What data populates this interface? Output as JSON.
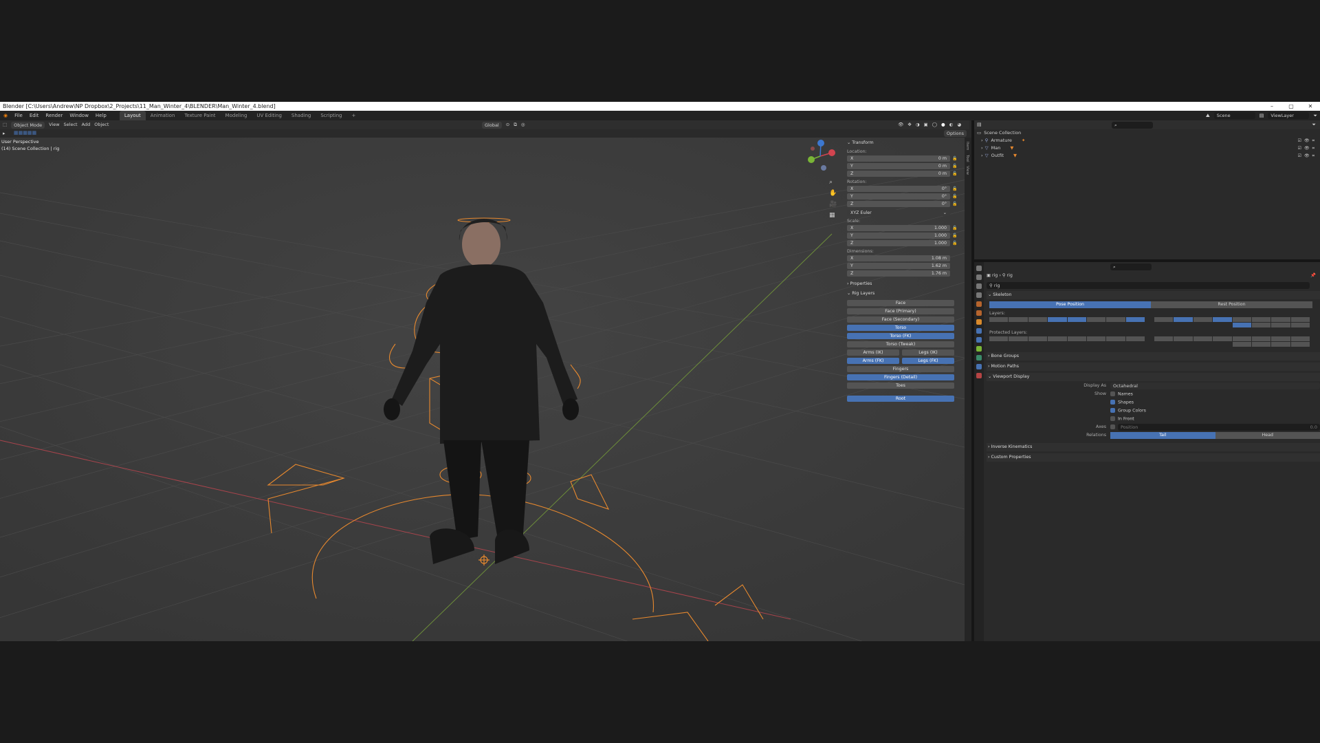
{
  "window": {
    "title": "Blender [C:\\Users\\Andrew\\NP Dropbox\\2_Projects\\11_Man_Winter_4\\BLENDER\\Man_Winter_4.blend]",
    "controls": [
      "–",
      "▢",
      "✕"
    ]
  },
  "menu": {
    "items": [
      "File",
      "Edit",
      "Render",
      "Window",
      "Help"
    ],
    "workspaces": [
      {
        "label": "Layout",
        "active": true
      },
      {
        "label": "Animation",
        "active": false
      },
      {
        "label": "Texture Paint",
        "active": false
      },
      {
        "label": "Modeling",
        "active": false
      },
      {
        "label": "UV Editing",
        "active": false
      },
      {
        "label": "Shading",
        "active": false
      },
      {
        "label": "Scripting",
        "active": false
      }
    ],
    "add_workspace": "+",
    "scene": "Scene",
    "view_layer": "ViewLayer"
  },
  "viewport_header": {
    "mode": "Object Mode",
    "menus": [
      "View",
      "Select",
      "Add",
      "Object"
    ],
    "orientation": "Global",
    "options": "Options"
  },
  "viewport": {
    "perspective": "User Perspective",
    "collection": "(14) Scene Collection | rig",
    "gizmo_axes": [
      "X",
      "Y",
      "Z"
    ]
  },
  "side_tabs": [
    "Item",
    "Tool",
    "View"
  ],
  "n_panel": {
    "transform_header": "Transform",
    "location_label": "Location:",
    "location": [
      {
        "axis": "X",
        "value": "0 m"
      },
      {
        "axis": "Y",
        "value": "0 m"
      },
      {
        "axis": "Z",
        "value": "0 m"
      }
    ],
    "rotation_label": "Rotation:",
    "rotation": [
      {
        "axis": "X",
        "value": "0°"
      },
      {
        "axis": "Y",
        "value": "0°"
      },
      {
        "axis": "Z",
        "value": "0°"
      }
    ],
    "rotation_mode": "XYZ Euler",
    "scale_label": "Scale:",
    "scale": [
      {
        "axis": "X",
        "value": "1.000"
      },
      {
        "axis": "Y",
        "value": "1.000"
      },
      {
        "axis": "Z",
        "value": "1.000"
      }
    ],
    "dimensions_label": "Dimensions:",
    "dimensions": [
      {
        "axis": "X",
        "value": "1.08 m"
      },
      {
        "axis": "Y",
        "value": "1.62 m"
      },
      {
        "axis": "Z",
        "value": "1.76 m"
      }
    ],
    "properties_header": "Properties",
    "rig_layers_header": "Rig Layers",
    "rig_layers": {
      "face": {
        "label": "Face",
        "on": false
      },
      "face_primary": {
        "label": "Face (Primary)",
        "on": false
      },
      "face_secondary": {
        "label": "Face (Secondary)",
        "on": false
      },
      "torso": {
        "label": "Torso",
        "on": true
      },
      "torso_fk": {
        "label": "Torso (FK)",
        "on": true
      },
      "torso_tweak": {
        "label": "Torso (Tweak)",
        "on": false
      },
      "arms_ik": {
        "label": "Arms (IK)",
        "on": false
      },
      "legs_ik": {
        "label": "Legs (IK)",
        "on": false
      },
      "arms_fk": {
        "label": "Arms (FK)",
        "on": true
      },
      "legs_fk": {
        "label": "Legs (FK)",
        "on": true
      },
      "fingers": {
        "label": "Fingers",
        "on": false
      },
      "fingers_detail": {
        "label": "Fingers (Detail)",
        "on": true
      },
      "toes": {
        "label": "Toes",
        "on": false
      },
      "root": {
        "label": "Root",
        "on": true
      }
    }
  },
  "outliner": {
    "root": "Scene Collection",
    "items": [
      "Armature",
      "Man",
      "Outfit"
    ]
  },
  "properties": {
    "breadcrumb": [
      "rig",
      "rig"
    ],
    "data_name": "rig",
    "skeleton_header": "Skeleton",
    "pose_position": "Pose Position",
    "rest_position": "Rest Position",
    "layers_label": "Layers:",
    "protected_layers_label": "Protected Layers:",
    "bone_groups": "Bone Groups",
    "motion_paths": "Motion Paths",
    "viewport_display": "Viewport Display",
    "display_as_label": "Display As",
    "display_as_value": "Octahedral",
    "show_label": "Show",
    "show_names": "Names",
    "show_shapes": "Shapes",
    "show_group_colors": "Group Colors",
    "show_in_front": "In Front",
    "axes_label": "Axes",
    "axes_position": "Position",
    "axes_value": "0.0",
    "relations_label": "Relations",
    "relations_tail": "Tail",
    "relations_head": "Head",
    "inverse_kinematics": "Inverse Kinematics",
    "custom_properties": "Custom Properties"
  },
  "colors": {
    "accent": "#4772b3",
    "selection_orange": "#e8892e",
    "x_axis": "#d2444f",
    "y_axis": "#79b536",
    "z_axis": "#3c78d0"
  }
}
